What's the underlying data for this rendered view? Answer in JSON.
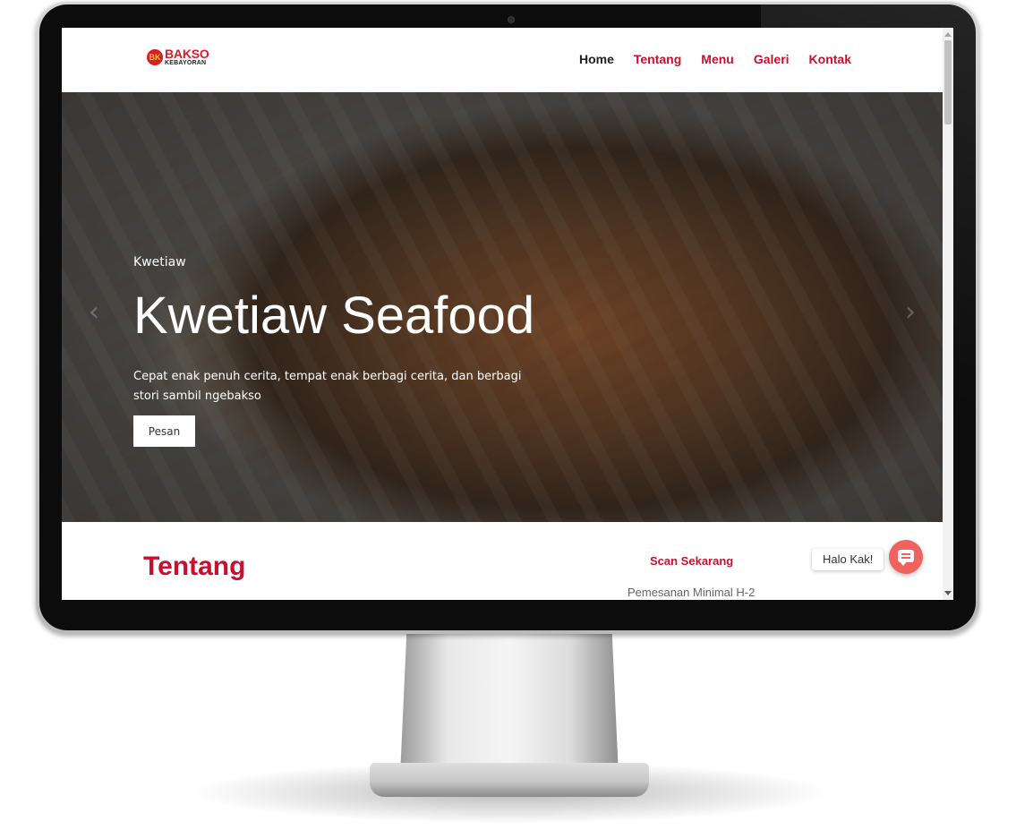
{
  "brand": {
    "logo_badge": "BK",
    "logo_main": "BAKSO",
    "logo_sub": "KEBAYORAN",
    "accent_color": "#c8102e"
  },
  "nav": {
    "items": [
      {
        "label": "Home",
        "active": true
      },
      {
        "label": "Tentang"
      },
      {
        "label": "Menu"
      },
      {
        "label": "Galeri"
      },
      {
        "label": "Kontak"
      }
    ]
  },
  "hero": {
    "kicker": "Kwetiaw",
    "title": "Kwetiaw Seafood",
    "description": "Cepat enak penuh cerita, tempat enak berbagi cerita, dan berbagi stori sambil ngebakso",
    "button_label": "Pesan",
    "prev_icon": "chevron-left-icon",
    "next_icon": "chevron-right-icon"
  },
  "about": {
    "title": "Tentang",
    "scan_title": "Scan Sekarang",
    "order_note": "Pemesanan Minimal H-2"
  },
  "chat": {
    "greeting": "Halo Kak!",
    "icon": "chat-icon",
    "color": "#f0625e"
  }
}
